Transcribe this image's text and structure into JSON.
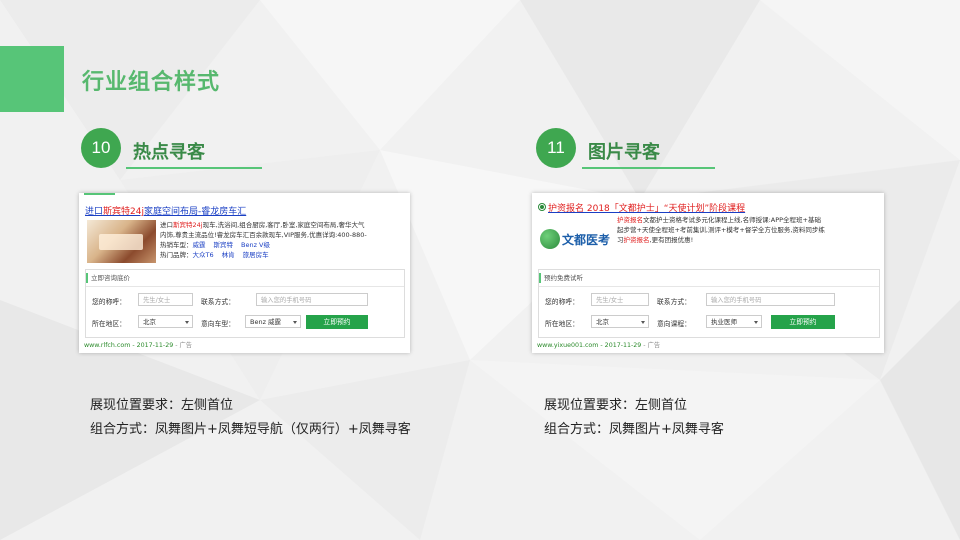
{
  "page": {
    "title": "行业组合样式"
  },
  "sections": [
    {
      "number": "10",
      "title": "热点寻客",
      "ad": {
        "headline_pre": "进口",
        "headline_red": "斯宾特24j",
        "headline_post": "家庭空间布局-睿龙房车汇",
        "desc_line1_pre": "进口",
        "desc_line1_red": "斯宾特24j",
        "desc_line1_post": "现车,洗浴间,组合厨房,客厅,卧室,家庭空间布局,奢华大气",
        "desc_line2": "内饰,尊贵主流品位!睿龙房车汇百余款现车,VIP服务,优惠详询:400-880-",
        "hot_model_label": "热销车型：",
        "hot_models": [
          "威霆",
          "斯宾特",
          "Benz V级"
        ],
        "hot_brand_label": "热门品牌：",
        "hot_brands": [
          "大众T6",
          "林肯",
          "旅居房车"
        ],
        "form_header": "立即咨询底价",
        "name_label": "您的称呼：",
        "name_placeholder": "先生/女士",
        "contact_label": "联系方式：",
        "contact_placeholder": "输入您的手机号码",
        "region_label": "所在地区：",
        "region_value": "北京",
        "car_label": "意向车型：",
        "car_value": "Benz 威霆",
        "submit": "立即预约",
        "url": "www.rlfch.com - 2017-11-29",
        "ad_mark": "- 广告"
      },
      "caption1": "展现位置要求：左侧首位",
      "caption2": "组合方式：凤舞图片+凤舞短导航（仅两行）+凤舞寻客"
    },
    {
      "number": "11",
      "title": "图片寻客",
      "ad": {
        "headline_red": "护资报名",
        "headline_post": " 2018「文都护士」“天使计划”阶段课程",
        "logo_text": "文都医考",
        "desc_line1_red": "护资报名",
        "desc_line1_post": "文都护士资格考试多元化课程上线,名师授课:APP全程班+基础",
        "desc_line2": "起步营+天使全程班+考前集训,测评+模考+督学全方位服务,资料同步练",
        "desc_line3_pre": "习",
        "desc_line3_red": "护资报名",
        "desc_line3_post": ",更有团报优惠!",
        "form_header": "预约免费试听",
        "name_label": "您的称呼：",
        "name_placeholder": "先生/女士",
        "contact_label": "联系方式：",
        "contact_placeholder": "输入您的手机号码",
        "region_label": "所在地区：",
        "region_value": "北京",
        "course_label": "意向课程：",
        "course_value": "执业医师",
        "submit": "立即预约",
        "url": "www.yixue001.com - 2017-11-29",
        "ad_mark": "- 广告"
      },
      "caption1": "展现位置要求：左侧首位",
      "caption2": "组合方式：凤舞图片+凤舞寻客"
    }
  ],
  "colors": {
    "accent": "#57c578",
    "badge": "#3fa750",
    "link": "#1a3fc4",
    "keyword": "#e02020"
  }
}
